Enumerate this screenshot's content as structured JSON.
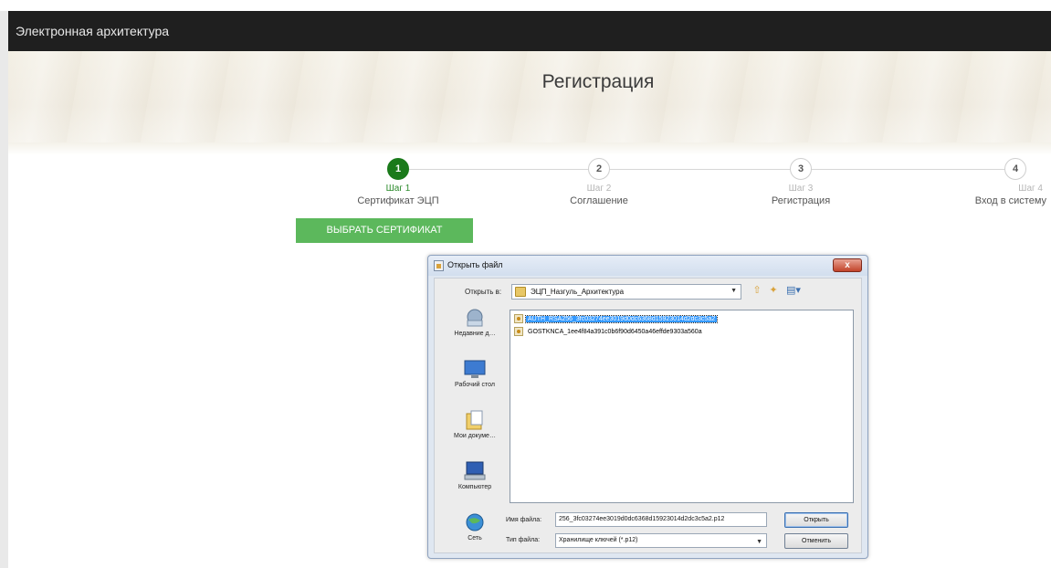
{
  "app": {
    "title": "Электронная архитектура"
  },
  "page": {
    "heading": "Регистрация"
  },
  "steps": [
    {
      "number": "1",
      "caption": "Шаг 1",
      "label": "Сертификат ЭЦП",
      "active": true
    },
    {
      "number": "2",
      "caption": "Шаг 2",
      "label": "Соглашение",
      "active": false
    },
    {
      "number": "3",
      "caption": "Шаг 3",
      "label": "Регистрация",
      "active": false
    },
    {
      "number": "4",
      "caption": "Шаг 4",
      "label": "Вход в систему",
      "active": false
    }
  ],
  "actions": {
    "choose_certificate": "ВЫБРАТЬ СЕРТИФИКАТ"
  },
  "dialog": {
    "title": "Открыть файл",
    "close": "x",
    "look_in_label": "Открыть в:",
    "look_in_value": "ЭЦП_Назгуль_Архитектура",
    "toolbar": {
      "up": "⇧",
      "new_folder": "✦",
      "view": "▤▾"
    },
    "places": [
      {
        "label": "Недавние д…",
        "icon": "recent-documents-icon"
      },
      {
        "label": "Рабочий стол",
        "icon": "desktop-icon"
      },
      {
        "label": "Мои докуме…",
        "icon": "my-documents-icon"
      },
      {
        "label": "Компьютер",
        "icon": "computer-icon"
      },
      {
        "label": "Сеть",
        "icon": "network-icon"
      }
    ],
    "files": [
      {
        "name": "AUTH_RSA256_3fc03274ee3019d0dc6368d15923014d2dc3c5a2",
        "selected": true
      },
      {
        "name": "GOSTKNCA_1ee4f84a391c0b6f90d6450a46effde9303a560a",
        "selected": false
      }
    ],
    "filename_label": "Имя файла:",
    "filename_value": "256_3fc03274ee3019d0dc6368d15923014d2dc3c5a2.p12",
    "filetype_label": "Тип файла:",
    "filetype_value": "Хранилище ключей (*.p12)",
    "open_button": "Открыть",
    "cancel_button": "Отменить"
  }
}
